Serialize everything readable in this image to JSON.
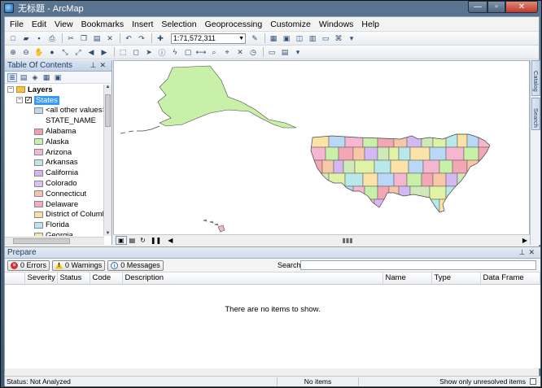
{
  "window": {
    "title": "无标题 - ArcMap",
    "min_glyph": "—",
    "max_glyph": "▫",
    "close_glyph": "✕"
  },
  "menu": [
    "File",
    "Edit",
    "View",
    "Bookmarks",
    "Insert",
    "Selection",
    "Geoprocessing",
    "Customize",
    "Windows",
    "Help"
  ],
  "toolbar": {
    "scale": "1:71,572,311"
  },
  "toc": {
    "title": "Table Of Contents",
    "layers_label": "Layers",
    "layer_name": "States",
    "other_values": "<all other values>",
    "field_name": "STATE_NAME",
    "states": [
      {
        "name": "Alabama",
        "color": "#f2a0b0"
      },
      {
        "name": "Alaska",
        "color": "#c7efa6"
      },
      {
        "name": "Arizona",
        "color": "#f4b8d2"
      },
      {
        "name": "Arkansas",
        "color": "#bfe7e9"
      },
      {
        "name": "California",
        "color": "#d9b3f0"
      },
      {
        "name": "Colorado",
        "color": "#d7c2f2"
      },
      {
        "name": "Connecticut",
        "color": "#f6c4a8"
      },
      {
        "name": "Delaware",
        "color": "#f5a9c7"
      },
      {
        "name": "District of Columbia",
        "color": "#f8e0a6"
      },
      {
        "name": "Florida",
        "color": "#b9e6f2"
      },
      {
        "name": "Georgia",
        "color": "#f0e6a0"
      }
    ]
  },
  "map": {
    "land_colors": [
      "#fbe3a8",
      "#c9f0a9",
      "#d4b8f2",
      "#b8e8e8",
      "#f5b6cf",
      "#f7c8a8",
      "#e0f2a6",
      "#b9d8f6",
      "#f3a6b3",
      "#cfe9b8"
    ]
  },
  "side_tabs": [
    "Catalog",
    "Search"
  ],
  "prepare": {
    "title": "Prepare",
    "errors": "0 Errors",
    "warnings": "0 Warnings",
    "messages": "0 Messages",
    "search_label": "Search:",
    "columns": [
      "",
      "Severity",
      "Status",
      "Code",
      "Description",
      "Name",
      "Type",
      "Data Frame"
    ],
    "empty": "There are no items to show."
  },
  "status": {
    "left": "Status: Not Analyzed",
    "middle": "No items",
    "right": "Show only unresolved items"
  }
}
